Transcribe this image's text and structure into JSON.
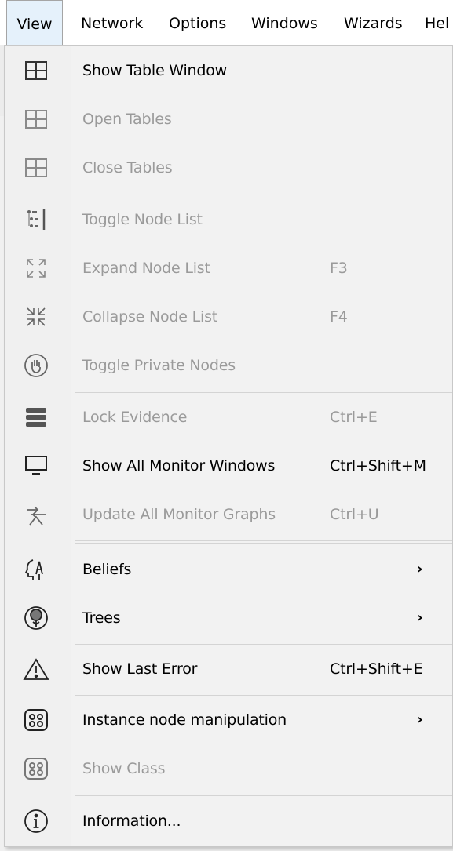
{
  "menubar": {
    "items": [
      "View",
      "Network",
      "Options",
      "Windows",
      "Wizards",
      "Hel"
    ]
  },
  "menu": {
    "items": [
      {
        "label": "Show Table Window",
        "shortcut": "",
        "icon": "table-icon"
      },
      {
        "label": "Open Tables",
        "shortcut": "",
        "icon": "table-icon"
      },
      {
        "label": "Close Tables",
        "shortcut": "",
        "icon": "table-icon"
      },
      {
        "label": "Toggle Node List",
        "shortcut": "",
        "icon": "node-list-icon"
      },
      {
        "label": "Expand Node List",
        "shortcut": "F3",
        "icon": "expand-icon"
      },
      {
        "label": "Collapse Node List",
        "shortcut": "F4",
        "icon": "collapse-icon"
      },
      {
        "label": "Toggle Private Nodes",
        "shortcut": "",
        "icon": "hand-icon"
      },
      {
        "label": "Lock Evidence",
        "shortcut": "Ctrl+E",
        "icon": "lock-evidence-icon"
      },
      {
        "label": "Show All Monitor Windows",
        "shortcut": "Ctrl+Shift+M",
        "icon": "monitor-icon"
      },
      {
        "label": "Update All Monitor Graphs",
        "shortcut": "Ctrl+U",
        "icon": "update-graphs-icon"
      },
      {
        "label": "Beliefs",
        "shortcut": "",
        "icon": "beliefs-icon"
      },
      {
        "label": "Trees",
        "shortcut": "",
        "icon": "tree-icon"
      },
      {
        "label": "Show Last Error",
        "shortcut": "Ctrl+Shift+E",
        "icon": "warning-icon"
      },
      {
        "label": "Instance node manipulation",
        "shortcut": "",
        "icon": "instance-node-icon"
      },
      {
        "label": "Show Class",
        "shortcut": "",
        "icon": "instance-node-icon"
      },
      {
        "label": "Information...",
        "shortcut": "",
        "icon": "info-icon"
      }
    ],
    "submenu_arrow": "›"
  },
  "colors": {
    "enabled_text": "#000000",
    "disabled_text": "#9a9a9a",
    "menubar_active_bg": "#e5f1fb"
  }
}
